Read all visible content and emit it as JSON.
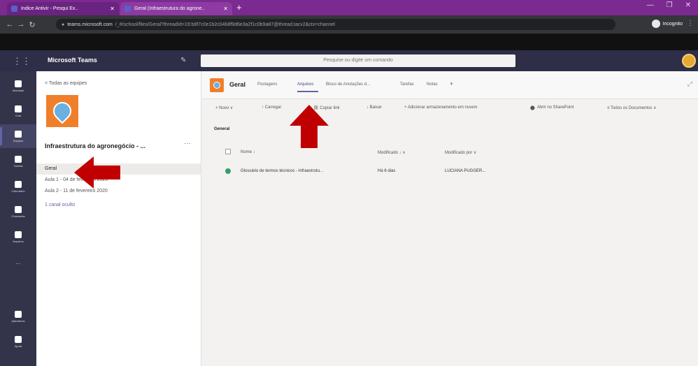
{
  "browser": {
    "tabs": [
      {
        "title": "Indice Antivir - Pesqui Ex..",
        "active": false
      },
      {
        "title": "Geral (Infraestrutura do agrone..",
        "active": true
      }
    ],
    "url_host": "teams.microsoft.com",
    "url_rest": "/_#/school/files/Geral?threadId=19:b8f7c0e1b2c04b8f9d6e3a2f1c0b9a87@thread.tacv2&ctx=channel",
    "profile_label": "Incognito"
  },
  "teams": {
    "app_title": "Microsoft Teams",
    "search_placeholder": "Pesquise ou digite um comando"
  },
  "rail": {
    "items": [
      {
        "label": "Atividade"
      },
      {
        "label": "Chat"
      },
      {
        "label": "Equipes"
      },
      {
        "label": "Tarefas"
      },
      {
        "label": "Calendário"
      },
      {
        "label": "Chamadas"
      },
      {
        "label": "Arquivos"
      },
      {
        "label": "..."
      },
      {
        "label": "Aplicativos"
      },
      {
        "label": "Ajuda"
      }
    ]
  },
  "team_panel": {
    "back_label": "< Todas as equipes",
    "team_name": "Infraestrutura do agronegócio - ...",
    "more": "···",
    "channels": [
      {
        "name": "Geral"
      },
      {
        "name": "Aula 1 - 04 de fevereiro 2020"
      },
      {
        "name": "Aula 2 - 11 de fevereiro 2020"
      }
    ],
    "hidden_channels": "1 canal oculto"
  },
  "channel": {
    "title": "Geral",
    "tabs": [
      "Postagens",
      "Arquivos",
      "Bloco de Anotações d...",
      "Tarefas",
      "Notas",
      "+"
    ]
  },
  "toolbar": {
    "items": [
      "+ Novo ∨",
      "↑ Carregar",
      "⛓ Copiar link",
      "↓ Baixar",
      "+ Adicionar armazenamento em nuvem",
      "Abrir no SharePoint",
      "≡ Todos os Documentos ∨"
    ]
  },
  "files": {
    "section": "General",
    "headers": [
      "Nome ↓",
      "Modificado ↓ ∨",
      "Modificado por ∨"
    ],
    "rows": [
      {
        "name": "Glossário de termos técnicos - Infraestrutu...",
        "modified": "Há 6 dias",
        "modified_by": "LUCIANA PUGGER..."
      }
    ]
  }
}
